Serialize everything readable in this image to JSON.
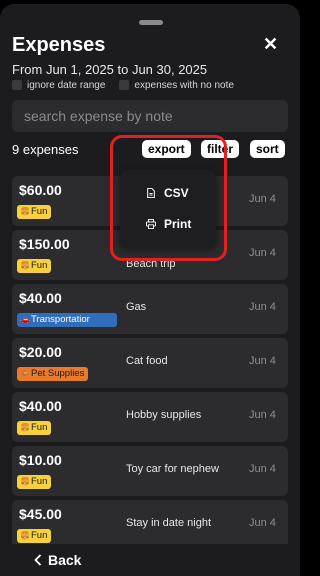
{
  "header": {
    "title": "Expenses",
    "close_label": "✕",
    "date_range": "From Jun 1, 2025 to Jun 30, 2025",
    "ignore_date_range": "ignore date range",
    "no_note": "expenses with no note"
  },
  "search": {
    "placeholder": "search expense by note"
  },
  "toolbar": {
    "count": "9 expenses",
    "export": "export",
    "filter": "filter",
    "sort": "sort"
  },
  "export_menu": {
    "items": [
      {
        "label": "CSV",
        "icon": "document-icon"
      },
      {
        "label": "Print",
        "icon": "printer-icon"
      }
    ]
  },
  "expenses": [
    {
      "amount": "$60.00",
      "category": "Fun",
      "icon": "burger-icon",
      "color": "#f7d13b",
      "note": "",
      "date": "Jun 4"
    },
    {
      "amount": "$150.00",
      "category": "Fun",
      "icon": "burger-icon",
      "color": "#f7d13b",
      "note": "Beach trip",
      "date": "Jun 4"
    },
    {
      "amount": "$40.00",
      "category": "Transportatior",
      "icon": "car-icon",
      "color": "#2f6dbd",
      "note": "Gas",
      "date": "Jun 4"
    },
    {
      "amount": "$20.00",
      "category": "Pet Supplies",
      "icon": "chair-icon",
      "color": "#e87a2e",
      "note": "Cat food",
      "date": "Jun 4"
    },
    {
      "amount": "$40.00",
      "category": "Fun",
      "icon": "burger-icon",
      "color": "#f7d13b",
      "note": "Hobby supplies",
      "date": "Jun 4"
    },
    {
      "amount": "$10.00",
      "category": "Fun",
      "icon": "burger-icon",
      "color": "#f7d13b",
      "note": "Toy car for nephew",
      "date": "Jun 4"
    },
    {
      "amount": "$45.00",
      "category": "Fun",
      "icon": "burger-icon",
      "color": "#f7d13b",
      "note": "Stay in date night",
      "date": "Jun 4"
    }
  ],
  "footer": {
    "back_label": "Back"
  },
  "colors": {
    "background": "#1c1c1e",
    "card": "#2c2c2e",
    "highlight": "#e32020"
  }
}
